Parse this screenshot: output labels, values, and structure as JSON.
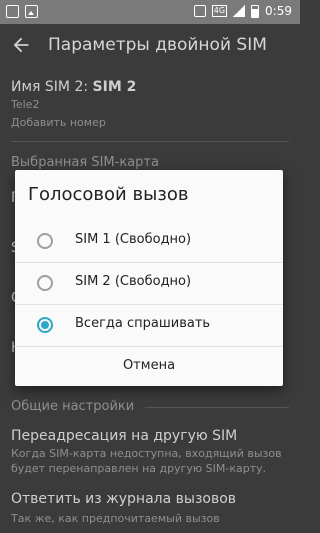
{
  "status_bar": {
    "network": "4G",
    "time": "0:59"
  },
  "app_bar": {
    "title": "Параметры двойной SIM"
  },
  "settings": {
    "sim2_name_label": "Имя SIM 2:",
    "sim2_name_value": "SIM 2",
    "sim2_operator": "Tele2",
    "add_number": "Добавить номер",
    "preferred_sim_section": "Выбранная SIM-карта",
    "general_section": "Общие настройки",
    "forwarding_title": "Переадресация на другую SIM",
    "forwarding_desc_line1": "Когда SIM-карта недоступна, входящий вызов",
    "forwarding_desc_line2": "будет перенаправлен на другую SIM-карту.",
    "reply_from_log_title": "Ответить из журнала вызовов",
    "reply_from_log_desc": "Так же, как предпочитаемый вызов"
  },
  "dialog": {
    "title": "Голосовой вызов",
    "options": [
      {
        "label": "SIM 1 (Свободно)",
        "selected": false
      },
      {
        "label": "SIM 2 (Свободно)",
        "selected": false
      },
      {
        "label": "Всегда спрашивать",
        "selected": true
      }
    ],
    "cancel_label": "Отмена"
  },
  "colors": {
    "accent": "#2aa8c4",
    "status_bar": "#7a7a7a"
  }
}
